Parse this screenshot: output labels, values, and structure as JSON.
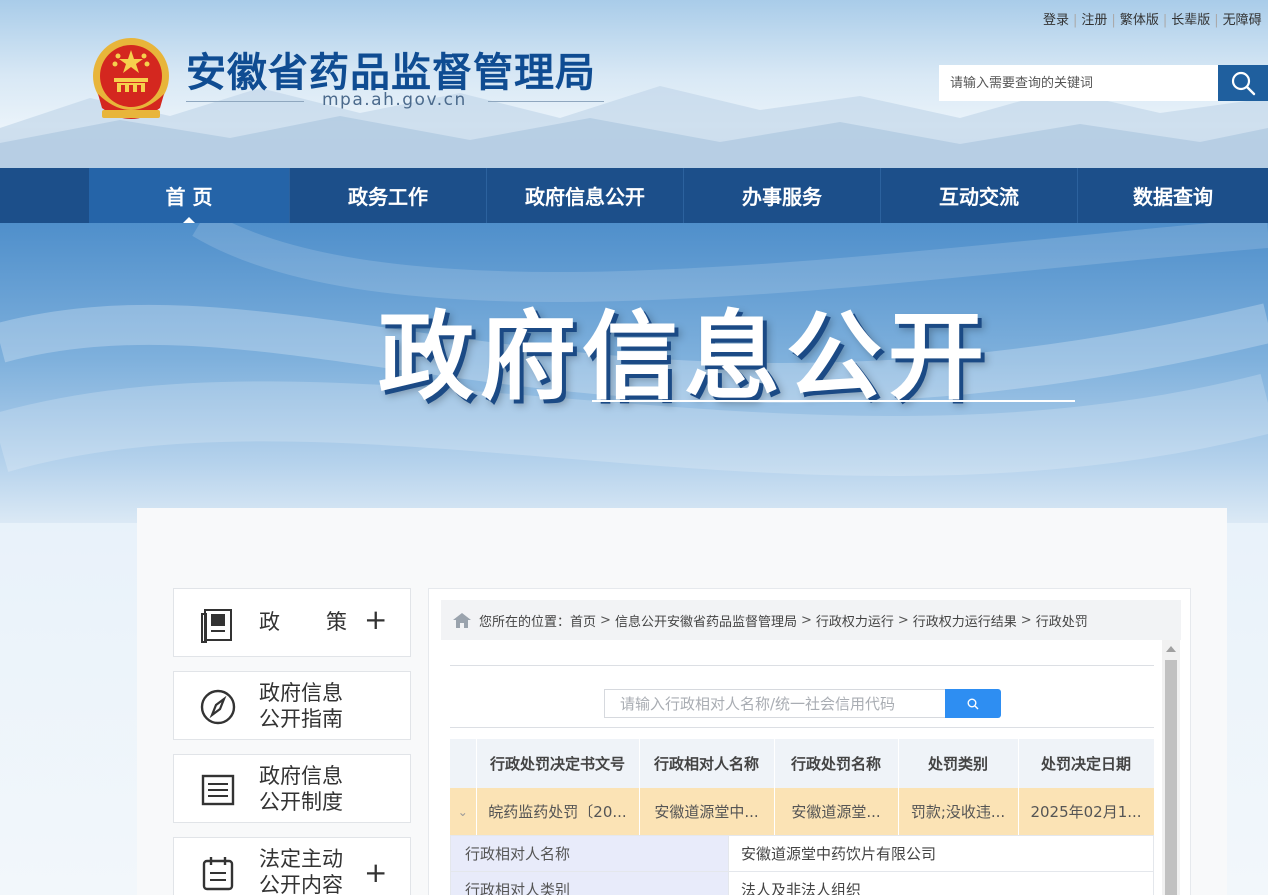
{
  "top_links": [
    "登录",
    "注册",
    "繁体版",
    "长辈版",
    "无障碍"
  ],
  "site": {
    "title": "安徽省药品监督管理局",
    "domain": "mpa.ah.gov.cn"
  },
  "search": {
    "placeholder": "请输入需要查询的关键词"
  },
  "nav": [
    {
      "label": "首 页",
      "active": true
    },
    {
      "label": "政务工作",
      "active": false
    },
    {
      "label": "政府信息公开",
      "active": false
    },
    {
      "label": "办事服务",
      "active": false
    },
    {
      "label": "互动交流",
      "active": false
    },
    {
      "label": "数据查询",
      "active": false
    }
  ],
  "banner": {
    "title": "政府信息公开"
  },
  "sidebar": {
    "items": [
      {
        "label_line1": "政",
        "label_line2": "策",
        "has_plus": true,
        "icon": "book-icon"
      },
      {
        "label_line1": "政府信息",
        "label_line2": "公开指南",
        "has_plus": false,
        "icon": "compass-icon"
      },
      {
        "label_line1": "政府信息",
        "label_line2": "公开制度",
        "has_plus": false,
        "icon": "list-icon"
      },
      {
        "label_line1": "法定主动",
        "label_line2": "公开内容",
        "has_plus": true,
        "icon": "clipboard-icon"
      }
    ],
    "plus": "+"
  },
  "breadcrumb": {
    "prefix": "您所在的位置：",
    "items": [
      "首页",
      "信息公开安徽省药品监督管理局",
      "行政权力运行",
      "行政权力运行结果",
      "行政处罚"
    ],
    "separator": ">"
  },
  "query": {
    "placeholder": "请输入行政相对人名称/统一社会信用代码"
  },
  "table": {
    "headers": [
      "行政处罚决定书文号",
      "行政相对人名称",
      "行政处罚名称",
      "处罚类别",
      "处罚决定日期"
    ],
    "row": {
      "expand_glyph": "⌄",
      "cells": [
        "皖药监药处罚〔20...",
        "安徽道源堂中...",
        "安徽道源堂...",
        "罚款;没收违...",
        "2025年02月1..."
      ]
    }
  },
  "detail": [
    {
      "key": "行政相对人名称",
      "value": "安徽道源堂中药饮片有限公司"
    },
    {
      "key": "行政相对人类别",
      "value": "法人及非法人组织"
    }
  ],
  "colors": {
    "nav_bg": "#1c4f8a",
    "nav_active": "#2564a8",
    "title_blue": "#0f4c92",
    "row_highlight": "#fbe3b5",
    "query_button": "#2e8ef2"
  }
}
